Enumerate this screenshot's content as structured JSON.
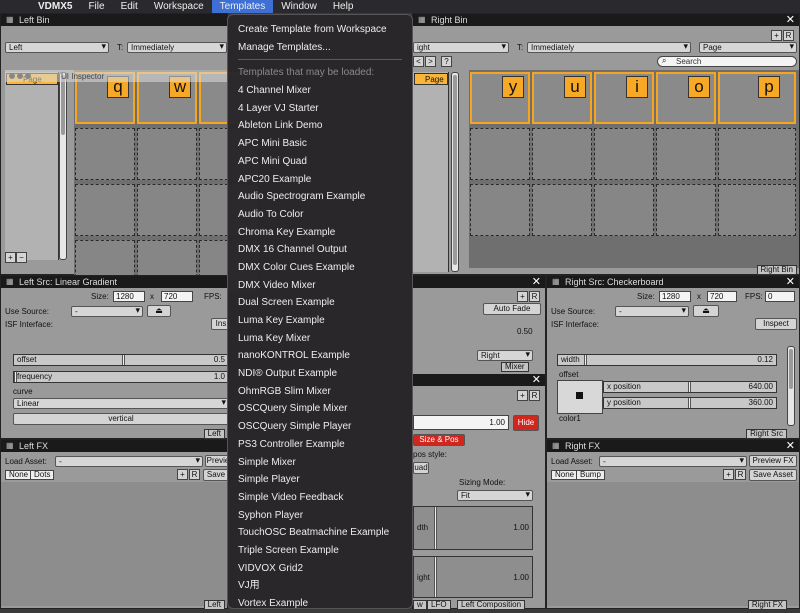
{
  "menubar": {
    "app_name": "VDMX5",
    "items": [
      "File",
      "Edit",
      "Workspace",
      "Templates",
      "Window",
      "Help"
    ]
  },
  "left_bin": {
    "title": "Left Bin",
    "mode": "Left",
    "transition_label": "T:",
    "transition": "Immediately",
    "page_label": "Page",
    "inspector_title": "UI Inspector",
    "keys": [
      "q",
      "w"
    ]
  },
  "right_bin": {
    "title": "Right Bin",
    "mode": "ight",
    "transition_label": "T:",
    "transition": "Immediately",
    "page_select": "Page",
    "search_placeholder": "Search",
    "page_label": "Page",
    "keys": [
      "y",
      "u",
      "i",
      "o",
      "p"
    ],
    "footer": "Right Bin"
  },
  "left_src": {
    "title": "Left Src: Linear Gradient",
    "size_label": "Size:",
    "width": "1280",
    "x_label": "x",
    "height": "720",
    "fps_label": "FPS:",
    "use_source_label": "Use Source:",
    "use_source": "-",
    "isf_label": "ISF Interface:",
    "inspect_label": "Ins",
    "params": [
      {
        "name": "offset",
        "value": "0.5"
      },
      {
        "name": "frequency",
        "value": "1.0"
      }
    ],
    "curve_label": "curve",
    "curve_value": "Linear",
    "vertical_label": "vertical",
    "footer": "Left"
  },
  "mixer": {
    "auto_fade": "Auto Fade",
    "value": "0.50",
    "right_select": "Right",
    "footer": "Mixer",
    "opacity_value": "1.00",
    "hide_label": "Hide",
    "size_pos_label": "Size & Pos",
    "pos_style_label": "pos style:",
    "quad_label": "uad",
    "sizing_mode_label": "Sizing Mode:",
    "sizing_mode": "Fit",
    "width_label": "dth",
    "width_value": "1.00",
    "height_label": "ight",
    "height_value": "1.00",
    "bottom_tabs": [
      "w",
      "LFO",
      "Left Composition"
    ]
  },
  "right_src": {
    "title": "Right Src: Checkerboard",
    "size_label": "Size:",
    "width": "1280",
    "x_label": "x",
    "height": "720",
    "fps_label": "FPS:",
    "fps": "0",
    "use_source_label": "Use Source:",
    "use_source": "-",
    "isf_label": "ISF Interface:",
    "inspect_label": "Inspect",
    "width_param": {
      "name": "width",
      "value": "0.12"
    },
    "offset_label": "offset",
    "x_position": {
      "name": "x position",
      "value": "640.00"
    },
    "y_position": {
      "name": "y position",
      "value": "360.00"
    },
    "color_label": "color1",
    "footer": "Right Src"
  },
  "left_fx": {
    "title": "Left FX",
    "load_asset_label": "Load Asset:",
    "load_asset": "-",
    "preview_label": "Previe",
    "none_tab": "None",
    "dots_tab": "Dots",
    "save_label": "Save",
    "footer": "Left"
  },
  "right_fx": {
    "title": "Right FX",
    "load_asset_label": "Load Asset:",
    "load_asset": "-",
    "preview_label": "Preview FX",
    "none_tab": "None",
    "bump_tab": "Bump",
    "save_label": "Save Asset",
    "footer": "Right FX"
  },
  "templates_menu": {
    "top_items": [
      "Create Template from Workspace",
      "Manage Templates..."
    ],
    "section_label": "Templates that may be loaded:",
    "templates": [
      "4 Channel Mixer",
      "4 Layer VJ Starter",
      "Ableton Link Demo",
      "APC Mini Basic",
      "APC Mini Quad",
      "APC20 Example",
      "Audio Spectrogram Example",
      "Audio To Color",
      "Chroma Key Example",
      "DMX 16 Channel Output",
      "DMX Color Cues Example",
      "DMX Video Mixer",
      "Dual Screen Example",
      "Luma Key Example",
      "Luma Key Mixer",
      "nanoKONTROL Example",
      "NDI® Output Example",
      "OhmRGB Slim Mixer",
      "OSCQuery Simple Mixer",
      "OSCQuery Simple Player",
      "PS3 Controller Example",
      "Simple Mixer",
      "Simple Player",
      "Simple Video Feedback",
      "Syphon Player",
      "TouchOSC Beatmachine Example",
      "Triple Screen Example",
      "VIDVOX Grid2",
      "VJ用",
      "Vortex Example"
    ]
  }
}
